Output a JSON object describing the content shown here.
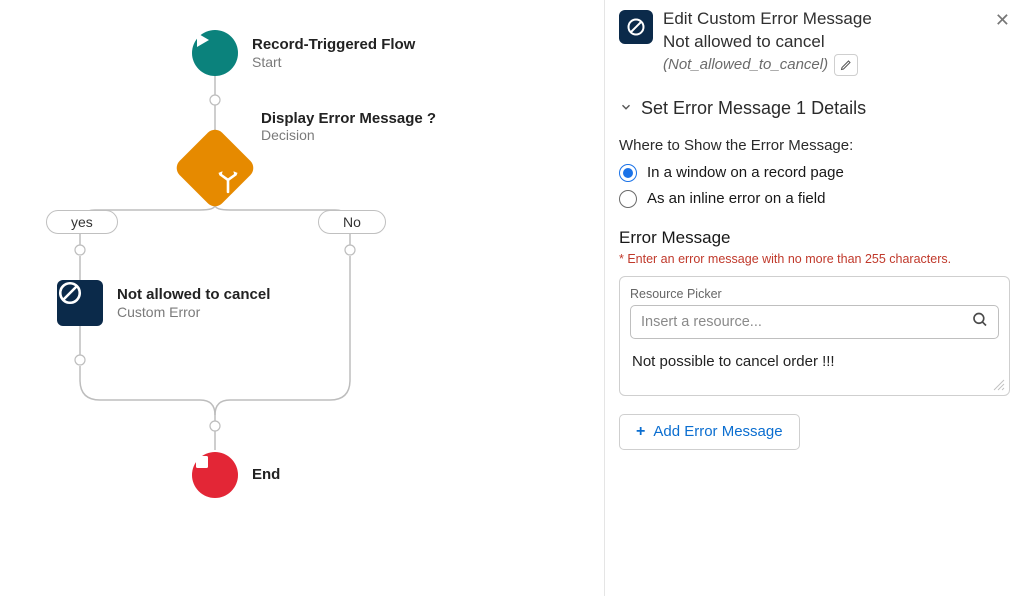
{
  "canvas": {
    "start": {
      "title": "Record-Triggered Flow",
      "subtitle": "Start"
    },
    "decision": {
      "title": "Display Error Message ?",
      "subtitle": "Decision"
    },
    "branch_yes": "yes",
    "branch_no": "No",
    "error_node": {
      "title": "Not allowed to cancel",
      "subtitle": "Custom Error"
    },
    "end": {
      "title": "End"
    }
  },
  "panel": {
    "header": {
      "line1": "Edit Custom Error Message",
      "line2": "Not allowed to cancel",
      "api_name": "(Not_allowed_to_cancel)"
    },
    "section_title": "Set Error Message 1 Details",
    "where_label": "Where to Show the Error Message:",
    "radios": {
      "window": "In a window on a record page",
      "inline": "As an inline error on a field"
    },
    "error_msg_title": "Error Message",
    "required_hint": "* Enter an error message with no more than 255 characters.",
    "picker_label": "Resource Picker",
    "picker_placeholder": "Insert a resource...",
    "message_value": "Not possible to cancel order !!!",
    "add_button": "Add Error Message"
  }
}
